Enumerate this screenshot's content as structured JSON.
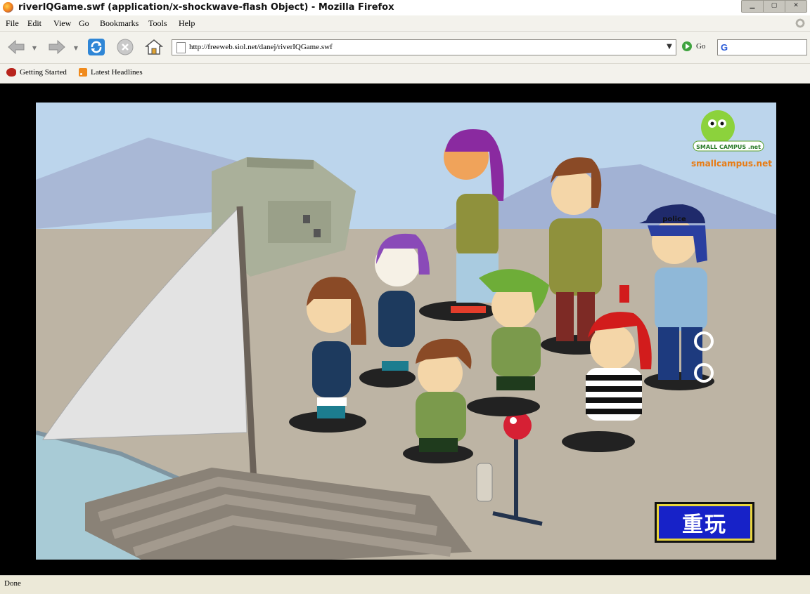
{
  "window": {
    "title": "riverIQGame.swf (application/x-shockwave-flash Object) - Mozilla Firefox",
    "controls": [
      "minimize",
      "maximize",
      "close"
    ]
  },
  "menubar": {
    "items": [
      {
        "label": "File",
        "underline": "F"
      },
      {
        "label": "Edit",
        "underline": "E"
      },
      {
        "label": "View",
        "underline": "V"
      },
      {
        "label": "Go",
        "underline": "G"
      },
      {
        "label": "Bookmarks",
        "underline": "B"
      },
      {
        "label": "Tools",
        "underline": "T"
      },
      {
        "label": "Help",
        "underline": "H"
      }
    ]
  },
  "navbar": {
    "url": "http://freeweb.siol.net/danej/riverIQGame.swf",
    "go_label": "Go",
    "search_engine_icon": "G",
    "search_value": ""
  },
  "bookmarks": {
    "items": [
      {
        "label": "Getting Started",
        "icon": "firefox-start-icon"
      },
      {
        "label": "Latest Headlines",
        "icon": "rss-feed-icon"
      }
    ]
  },
  "flash_game": {
    "logo_text": "smallcampus.net",
    "logo_badge_text": "SMALL CAMPUS .net",
    "police_cap_text": "police",
    "replay_button_label": "重玩"
  },
  "statusbar": {
    "text": "Done"
  },
  "colors": {
    "sky": "#b9d3ea",
    "ground": "#bfb6a6",
    "water": "#a9c9d3",
    "replay_bg": "#1722c8",
    "replay_border": "#e9d53c",
    "logo": "#e87b12"
  }
}
